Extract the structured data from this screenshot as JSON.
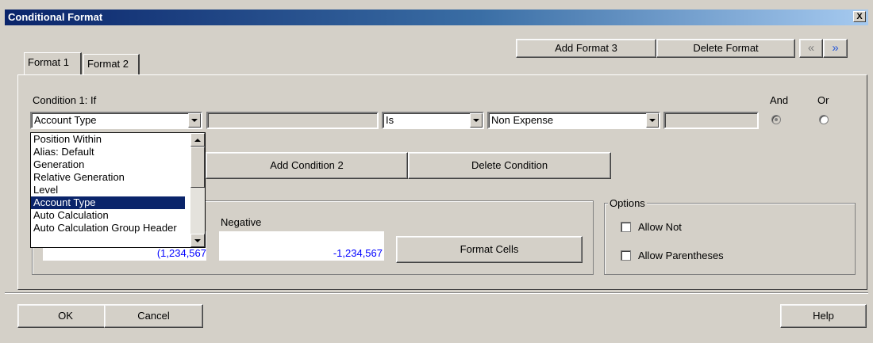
{
  "window": {
    "title": "Conditional Format",
    "close_symbol": "X"
  },
  "toolbar": {
    "add_format": "Add Format 3",
    "delete_format": "Delete Format",
    "prev_symbol": "«",
    "next_symbol": "»"
  },
  "tabs": [
    {
      "label": "Format 1",
      "active": true
    },
    {
      "label": "Format 2",
      "active": false
    }
  ],
  "condition": {
    "label": "Condition 1: If",
    "field_combo": "Account Type",
    "value_input": "",
    "operator_combo": "Is",
    "value_combo": "Non Expense",
    "extra_input": "",
    "and_label": "And",
    "or_label": "Or",
    "and_selected": true
  },
  "dropdown": {
    "items": [
      "Position Within",
      "Alias: Default",
      "Generation",
      "Relative Generation",
      "Level",
      "Account Type",
      "Auto Calculation",
      "Auto Calculation Group Header"
    ],
    "selected_index": 5
  },
  "condition_buttons": {
    "add_condition": "Add Condition 2",
    "delete_condition": "Delete Condition"
  },
  "formatting": {
    "positive_value": "(1,234,567",
    "negative_label": "Negative",
    "negative_value": "-1,234,567",
    "format_cells": "Format Cells"
  },
  "options": {
    "title": "Options",
    "allow_not": "Allow Not",
    "allow_parentheses": "Allow Parentheses"
  },
  "footer": {
    "ok": "OK",
    "cancel": "Cancel",
    "help": "Help"
  },
  "colors": {
    "title_start": "#0a246a",
    "title_end": "#a6caf0",
    "value_blue": "#0000ff",
    "face": "#d4d0c8"
  }
}
